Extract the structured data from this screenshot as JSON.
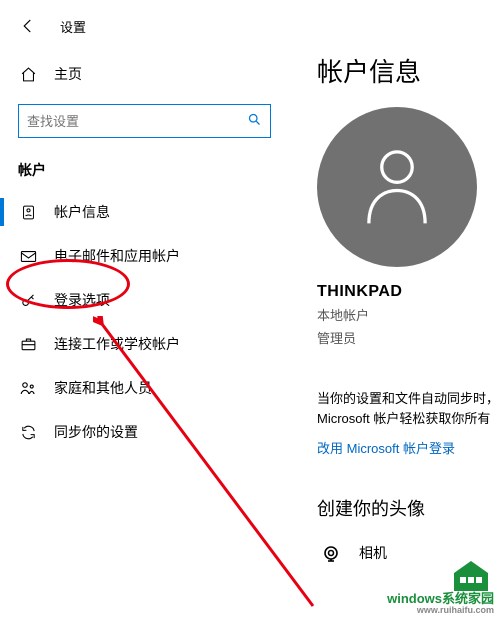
{
  "header": {
    "title": "设置"
  },
  "sidebar": {
    "home_label": "主页",
    "search_placeholder": "查找设置",
    "section_title": "帐户",
    "items": [
      {
        "icon": "person-icon",
        "label": "帐户信息",
        "active": true
      },
      {
        "icon": "mail-icon",
        "label": "电子邮件和应用帐户",
        "active": false
      },
      {
        "icon": "key-icon",
        "label": "登录选项",
        "active": false
      },
      {
        "icon": "briefcase-icon",
        "label": "连接工作或学校帐户",
        "active": false
      },
      {
        "icon": "family-icon",
        "label": "家庭和其他人员",
        "active": false
      },
      {
        "icon": "sync-icon",
        "label": "同步你的设置",
        "active": false
      }
    ]
  },
  "content": {
    "page_title": "帐户信息",
    "user_name": "THINKPAD",
    "account_type": "本地帐户",
    "role": "管理员",
    "sync_text": "当你的设置和文件自动同步时，Microsoft 帐户轻松获取你所有",
    "ms_link": "改用 Microsoft 帐户登录",
    "create_title": "创建你的头像",
    "camera_label": "相机"
  },
  "watermark": {
    "brand": "windows系统家园",
    "url": "www.ruihaifu.com"
  }
}
